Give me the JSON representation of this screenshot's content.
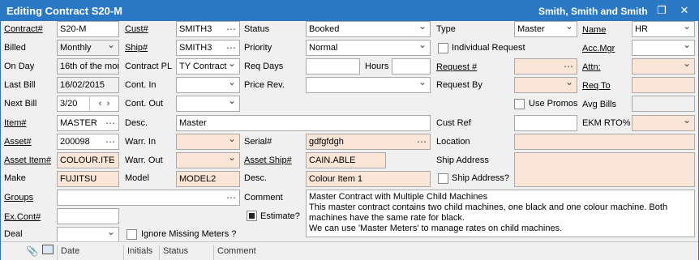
{
  "title": "Editing Contract S20-M",
  "company": "Smith, Smith and Smith",
  "window_icons": [
    "restore-icon",
    "close-icon"
  ],
  "labels": {
    "contract": "Contract#",
    "billed": "Billed",
    "on_day": "On Day",
    "last_bill": "Last Bill",
    "next_bill": "Next Bill",
    "item": "Item#",
    "asset": "Asset#",
    "asset_item": "Asset Item#",
    "make": "Make",
    "groups": "Groups",
    "ex_cont": "Ex.Cont#",
    "deal": "Deal",
    "cust": "Cust#",
    "ship": "Ship#",
    "contract_pl": "Contract PL",
    "cont_in": "Cont. In",
    "cont_out": "Cont. Out",
    "desc": "Desc.",
    "warr_in": "Warr. In",
    "warr_out": "Warr. Out",
    "model": "Model",
    "ignore_meters": "Ignore Missing Meters ?",
    "status": "Status",
    "priority": "Priority",
    "req_days": "Req Days",
    "hours": "Hours",
    "price_rev": "Price Rev.",
    "serial": "Serial#",
    "asset_ship": "Asset Ship#",
    "desc2": "Desc.",
    "comment": "Comment",
    "estimate": "Estimate?",
    "type": "Type",
    "individual_request": "Individual Request",
    "request_no": "Request #",
    "request_by": "Request By",
    "use_promos": "Use Promos",
    "cust_ref": "Cust Ref",
    "location": "Location",
    "ship_address": "Ship Address",
    "ship_address_q": "Ship Address?",
    "name": "Name",
    "acc_mgr": "Acc.Mgr",
    "attn": "Attn:",
    "req_to": "Req To",
    "avg_bills": "Avg Bills",
    "ekm_rto": "EKM RTO%"
  },
  "values": {
    "contract": "S20-M",
    "billed": "Monthly",
    "on_day": "16th of the mon",
    "last_bill": "16/02/2015",
    "next_bill": "3/20",
    "item": "MASTER",
    "asset": "200098",
    "asset_item": "COLOUR.ITE",
    "make": "FUJITSU",
    "groups": "",
    "ex_cont": "",
    "deal": "",
    "cust": "SMITH3",
    "ship": "SMITH3",
    "contract_pl": "TY Contract",
    "cont_in": "",
    "cont_out": "",
    "desc": "Master",
    "warr_in": "",
    "warr_out": "",
    "model": "MODEL2",
    "status": "Booked",
    "priority": "Normal",
    "req_days": "",
    "hours": "",
    "price_rev": "",
    "serial": "gdfgfdgh",
    "asset_ship": "CAIN.ABLE",
    "desc2": "Colour Item 1",
    "comment": "Master Contract with Multiple Child Machines\nThis master contract contains two child machines, one black and one colour machine. Both machines have the same rate for black.\nWe can use 'Master Meters' to manage rates on child machines.",
    "type": "Master",
    "request_no": "",
    "request_by": "",
    "cust_ref": "",
    "location": "",
    "ship_address": "",
    "name": "HR",
    "acc_mgr": "",
    "attn": "",
    "req_to": "",
    "avg_bills": "",
    "ekm_rto": ""
  },
  "checks": {
    "estimate": true,
    "individual_request": false,
    "use_promos": false,
    "ignore_meters": false,
    "ship_address": false
  },
  "grid_headers": [
    "Date",
    "Initials",
    "Status",
    "Comment"
  ],
  "grid_icons": [
    "attachment-icon",
    "note-icon"
  ],
  "spinner": {
    "left": "‹",
    "right": "›"
  }
}
